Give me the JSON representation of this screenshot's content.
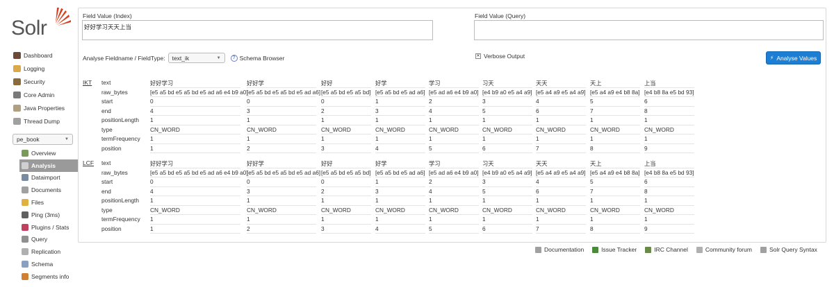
{
  "logo": {
    "text": "Solr"
  },
  "nav": [
    {
      "label": "Dashboard",
      "icon": "dashboard-icon",
      "color": "#6b4a3a"
    },
    {
      "label": "Logging",
      "icon": "logging-icon",
      "color": "#d9a94a"
    },
    {
      "label": "Security",
      "icon": "security-icon",
      "color": "#8a6a3a"
    },
    {
      "label": "Core Admin",
      "icon": "core-admin-icon",
      "color": "#7a7a7a"
    },
    {
      "label": "Java Properties",
      "icon": "java-properties-icon",
      "color": "#b0a080"
    },
    {
      "label": "Thread Dump",
      "icon": "thread-dump-icon",
      "color": "#a0a0a0"
    }
  ],
  "core_select": {
    "value": "pe_book"
  },
  "core_nav": [
    {
      "label": "Overview",
      "icon": "overview-icon",
      "color": "#7a9a5a",
      "active": false
    },
    {
      "label": "Analysis",
      "icon": "analysis-icon",
      "color": "#d0d0d0",
      "active": true
    },
    {
      "label": "Dataimport",
      "icon": "dataimport-icon",
      "color": "#7a8aa0",
      "active": false
    },
    {
      "label": "Documents",
      "icon": "documents-icon",
      "color": "#a0a0a0",
      "active": false
    },
    {
      "label": "Files",
      "icon": "files-icon",
      "color": "#e0b040",
      "active": false
    },
    {
      "label": "Ping (3ms)",
      "icon": "ping-icon",
      "color": "#606060",
      "active": false
    },
    {
      "label": "Plugins / Stats",
      "icon": "plugins-icon",
      "color": "#c04060",
      "active": false
    },
    {
      "label": "Query",
      "icon": "query-icon",
      "color": "#909090",
      "active": false
    },
    {
      "label": "Replication",
      "icon": "replication-icon",
      "color": "#b0b0b0",
      "active": false
    },
    {
      "label": "Schema",
      "icon": "schema-icon",
      "color": "#8aa0c0",
      "active": false
    },
    {
      "label": "Segments info",
      "icon": "segments-icon",
      "color": "#d08030",
      "active": false
    }
  ],
  "field_index": {
    "label": "Field Value (Index)",
    "value": "好好学习天天上当"
  },
  "field_query": {
    "label": "Field Value (Query)",
    "value": ""
  },
  "analyse": {
    "label": "Analyse Fieldname / FieldType:",
    "fieldtype": "text_ik",
    "schema_browser": "Schema Browser",
    "verbose": "Verbose Output",
    "verbose_checked": true,
    "button": "Analyse Values"
  },
  "row_labels": [
    "text",
    "raw_bytes",
    "start",
    "end",
    "positionLength",
    "type",
    "termFrequency",
    "position"
  ],
  "tokenizers": [
    {
      "name": "IKT",
      "tokens": [
        [
          "好好学习",
          "[e5 a5 bd e5 a5 bd e5 ad a6 e4 b9 a0]",
          "0",
          "4",
          "1",
          "CN_WORD",
          "1",
          "1"
        ],
        [
          "好好学",
          "[e5 a5 bd e5 a5 bd e5 ad a6]",
          "0",
          "3",
          "1",
          "CN_WORD",
          "1",
          "2"
        ],
        [
          "好好",
          "[e5 a5 bd e5 a5 bd]",
          "0",
          "2",
          "1",
          "CN_WORD",
          "1",
          "3"
        ],
        [
          "好学",
          "[e5 a5 bd e5 ad a6]",
          "1",
          "3",
          "1",
          "CN_WORD",
          "1",
          "4"
        ],
        [
          "学习",
          "[e5 ad a6 e4 b9 a0]",
          "2",
          "4",
          "1",
          "CN_WORD",
          "1",
          "5"
        ],
        [
          "习天",
          "[e4 b9 a0 e5 a4 a9]",
          "3",
          "5",
          "1",
          "CN_WORD",
          "1",
          "6"
        ],
        [
          "天天",
          "[e5 a4 a9 e5 a4 a9]",
          "4",
          "6",
          "1",
          "CN_WORD",
          "1",
          "7"
        ],
        [
          "天上",
          "[e5 a4 a9 e4 b8 8a]",
          "5",
          "7",
          "1",
          "CN_WORD",
          "1",
          "8"
        ],
        [
          "上当",
          "[e4 b8 8a e5 bd 93]",
          "6",
          "8",
          "1",
          "CN_WORD",
          "1",
          "9"
        ]
      ]
    },
    {
      "name": "LCF",
      "tokens": [
        [
          "好好学习",
          "[e5 a5 bd e5 a5 bd e5 ad a6 e4 b9 a0]",
          "0",
          "4",
          "1",
          "CN_WORD",
          "1",
          "1"
        ],
        [
          "好好学",
          "[e5 a5 bd e5 a5 bd e5 ad a6]",
          "0",
          "3",
          "1",
          "CN_WORD",
          "1",
          "2"
        ],
        [
          "好好",
          "[e5 a5 bd e5 a5 bd]",
          "0",
          "2",
          "1",
          "CN_WORD",
          "1",
          "3"
        ],
        [
          "好学",
          "[e5 a5 bd e5 ad a6]",
          "1",
          "3",
          "1",
          "CN_WORD",
          "1",
          "4"
        ],
        [
          "学习",
          "[e5 ad a6 e4 b9 a0]",
          "2",
          "4",
          "1",
          "CN_WORD",
          "1",
          "5"
        ],
        [
          "习天",
          "[e4 b9 a0 e5 a4 a9]",
          "3",
          "5",
          "1",
          "CN_WORD",
          "1",
          "6"
        ],
        [
          "天天",
          "[e5 a4 a9 e5 a4 a9]",
          "4",
          "6",
          "1",
          "CN_WORD",
          "1",
          "7"
        ],
        [
          "天上",
          "[e5 a4 a9 e4 b8 8a]",
          "5",
          "7",
          "1",
          "CN_WORD",
          "1",
          "8"
        ],
        [
          "上当",
          "[e4 b8 8a e5 bd 93]",
          "6",
          "8",
          "1",
          "CN_WORD",
          "1",
          "9"
        ]
      ]
    }
  ],
  "footer": [
    {
      "label": "Documentation",
      "icon": "documentation-icon",
      "color": "#a0a0a0"
    },
    {
      "label": "Issue Tracker",
      "icon": "issue-tracker-icon",
      "color": "#4a8a3a"
    },
    {
      "label": "IRC Channel",
      "icon": "irc-channel-icon",
      "color": "#6a8a4a"
    },
    {
      "label": "Community forum",
      "icon": "community-forum-icon",
      "color": "#b0b0b0"
    },
    {
      "label": "Solr Query Syntax",
      "icon": "query-syntax-icon",
      "color": "#a0a0a0"
    }
  ]
}
